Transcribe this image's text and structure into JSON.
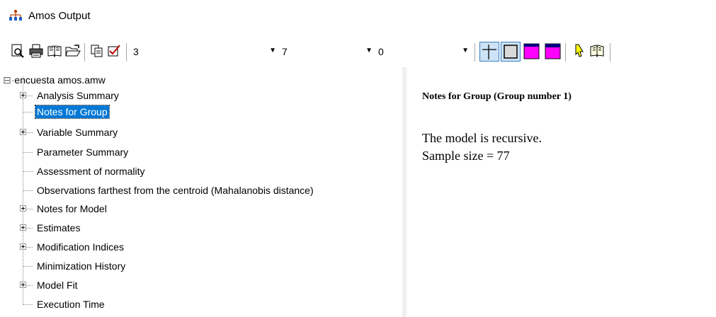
{
  "window": {
    "title": "Amos Output"
  },
  "toolbar": {
    "combos": [
      {
        "value": "3"
      },
      {
        "value": "7"
      },
      {
        "value": "0"
      }
    ],
    "icons": [
      "print-preview-icon",
      "print-icon",
      "book-icon",
      "open-folder-icon",
      "copy-icon",
      "checkbox-icon",
      "grid-lines-icon",
      "table-border-icon",
      "magenta-header-icon",
      "magenta-table-icon",
      "pointer-help-icon",
      "open-book-icon"
    ]
  },
  "tree": {
    "root": "encuesta amos.amw",
    "items": [
      {
        "label": "Analysis Summary",
        "expandable": true
      },
      {
        "label": "Notes for Group",
        "expandable": false,
        "selected": true
      },
      {
        "label": "Variable Summary",
        "expandable": true
      },
      {
        "label": "Parameter Summary",
        "expandable": false
      },
      {
        "label": "Assessment of normality",
        "expandable": false
      },
      {
        "label": "Observations farthest from the centroid (Mahalanobis distance)",
        "expandable": false
      },
      {
        "label": "Notes for Model",
        "expandable": true
      },
      {
        "label": "Estimates",
        "expandable": true
      },
      {
        "label": "Modification Indices",
        "expandable": true
      },
      {
        "label": "Minimization History",
        "expandable": false
      },
      {
        "label": "Model Fit",
        "expandable": true
      },
      {
        "label": "Execution Time",
        "expandable": false
      }
    ]
  },
  "content": {
    "heading": "Notes for Group (Group number 1)",
    "lines": [
      "The model is recursive.",
      "Sample size = 77"
    ]
  },
  "colors": {
    "selection": "#0078d7",
    "magenta": "#ff00ff",
    "navy": "#000080"
  }
}
